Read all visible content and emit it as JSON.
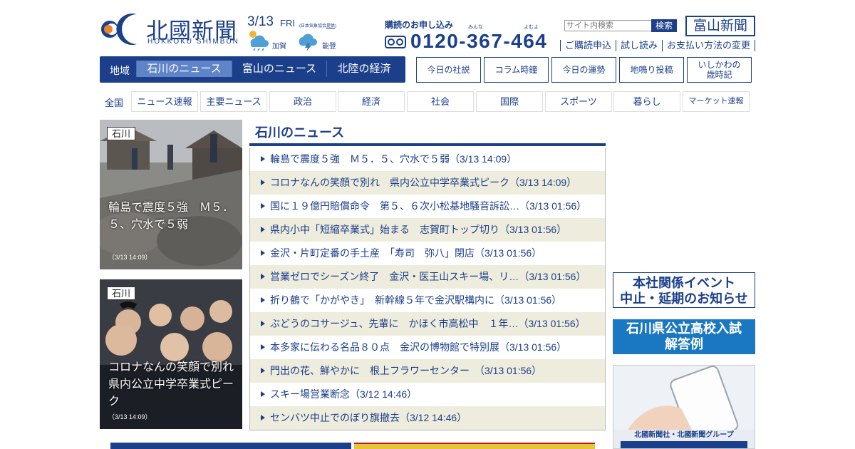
{
  "header": {
    "logo_jp": "北國新聞",
    "logo_en": "HOKKOKU SHIMBUN",
    "date": "3/13",
    "weekday": "FRI",
    "weather_source_pre": "(日本気象協会",
    "weather_source_link": "提供",
    "weather_source_post": ")",
    "weather": [
      {
        "area": "加賀",
        "icon": "rain-cloud-icon"
      },
      {
        "area": "能登",
        "icon": "lightning-cloud-icon"
      }
    ]
  },
  "subscribe": {
    "title": "購読のお申し込み",
    "ruby1": "みんな",
    "ruby2": "よむよ",
    "phone": "0120-367-464"
  },
  "search": {
    "placeholder": "サイト内検索",
    "button": "検索"
  },
  "toyama_button": "富山新聞",
  "account_links": [
    "ご購読申込",
    "試し読み",
    "お支払い方法の変更"
  ],
  "region_nav": {
    "label": "地域",
    "tabs": [
      "石川のニュース",
      "富山のニュース",
      "北陸の経済"
    ],
    "active": 0
  },
  "box_buttons": [
    "今日の社説",
    "コラム時鐘",
    "今日の運勢",
    "地鳴り投稿",
    "いしかわの\n歳時記"
  ],
  "genre_nav": {
    "label": "全国",
    "tabs": [
      "ニュース速報",
      "主要ニュース",
      "政治",
      "経済",
      "社会",
      "国際",
      "スポーツ",
      "暮らし",
      "マーケット速報"
    ]
  },
  "photo_cards": [
    {
      "tag": "石川",
      "title": "輪島で震度５強　Ｍ５．５、穴水で５弱",
      "time": "（3/13 14:09）"
    },
    {
      "tag": "石川",
      "title": "コロナなんの笑顔で別れ　県内公立中学卒業式ピーク",
      "time": "（3/13 14:09）"
    }
  ],
  "news_section": {
    "title": "石川のニュース",
    "items": [
      "輪島で震度５強　Ｍ５．５、穴水で５弱（3/13 14:09）",
      "コロナなんの笑顔で別れ　県内公立中学卒業式ピーク（3/13 14:09）",
      "国に１９億円賠償命令　第５、６次小松基地騒音訴訟…（3/13 01:56）",
      "県内小中「短縮卒業式」始まる　志賀町トップ切り（3/13 01:56）",
      "金沢・片町定番の手土産　「寿司　弥八」閉店（3/13 01:56）",
      "営業ゼロでシーズン終了　金沢・医王山スキー場、リ…（3/13 01:56）",
      "折り鶴で「かがやき」　新幹線５年で金沢駅構内に（3/13 01:56）",
      "ぶどうのコサージュ、先輩に　かほく市高松中　１年…（3/13 01:56）",
      "本多家に伝わる名品８０点　金沢の博物館で特別展（3/13 01:56）",
      "門出の花、鮮やかに　根上フラワーセンター　（3/13 01:56）",
      "スキー場営業断念（3/12 14:46）",
      "センバツ中止でのぼり旗撤去（3/12 14:46）"
    ]
  },
  "banners": {
    "event_line1": "本社関係イベント",
    "event_line2": "中止・延期のお知らせ",
    "exam_line1": "石川県公立高校入試",
    "exam_line2": "解答例",
    "group_caption": "北國新聞社・北國新聞グループ"
  },
  "colors": {
    "brand": "#1b3f8b",
    "active_tab": "#5f84c8",
    "stripe": "#eeecdc",
    "exam_banner": "#1a77c2"
  }
}
